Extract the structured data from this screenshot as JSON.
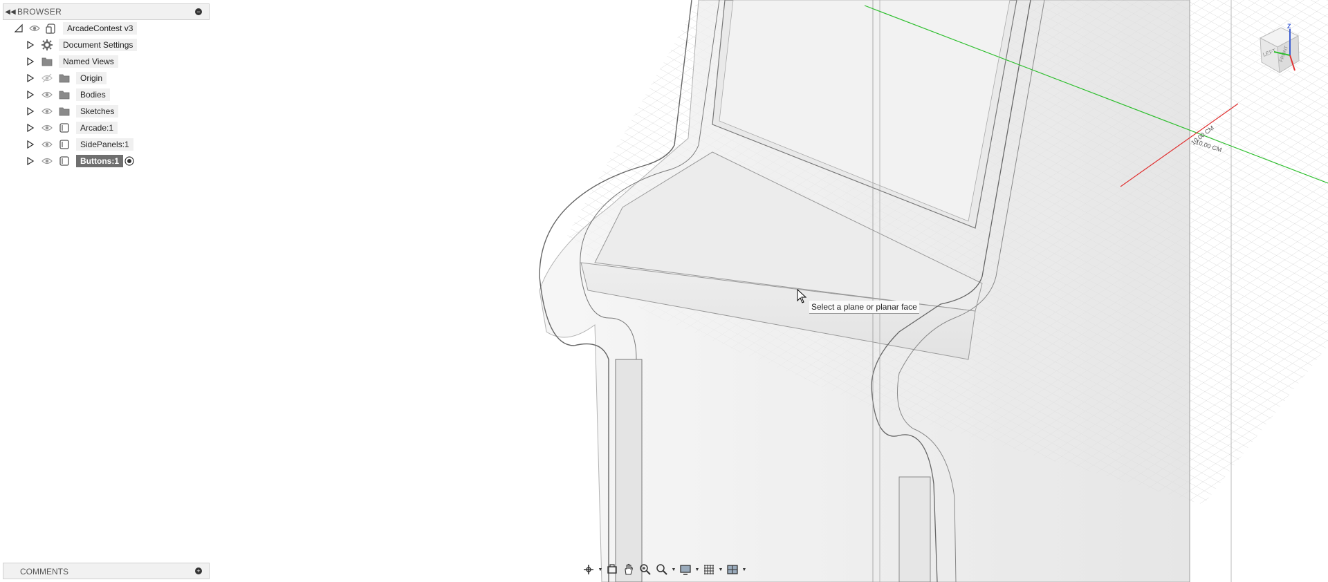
{
  "browser": {
    "title": "BROWSER",
    "root": "ArcadeContest v3",
    "items": [
      {
        "label": "Document Settings",
        "icon": "gear-icon"
      },
      {
        "label": "Named Views",
        "icon": "folder-icon"
      },
      {
        "label": "Origin",
        "icon": "folder-icon"
      },
      {
        "label": "Bodies",
        "icon": "folder-icon"
      },
      {
        "label": "Sketches",
        "icon": "folder-icon"
      },
      {
        "label": "Arcade:1",
        "icon": "component-icon"
      },
      {
        "label": "SidePanels:1",
        "icon": "component-icon"
      },
      {
        "label": "Buttons:1",
        "icon": "component-icon",
        "selected": true
      }
    ]
  },
  "comments": {
    "title": "COMMENTS"
  },
  "viewport": {
    "tooltip": "Select a plane or planar face",
    "dim_text_1": "10.00 CM",
    "dim_text_2": "10.00 CM"
  },
  "viewcube": {
    "face_left": "LEFT",
    "face_front": "FRONT",
    "axis_z": "Z"
  },
  "colors": {
    "x_axis": "#e03030",
    "y_axis": "#2fbf2f",
    "selection": "#6f6f6f"
  }
}
